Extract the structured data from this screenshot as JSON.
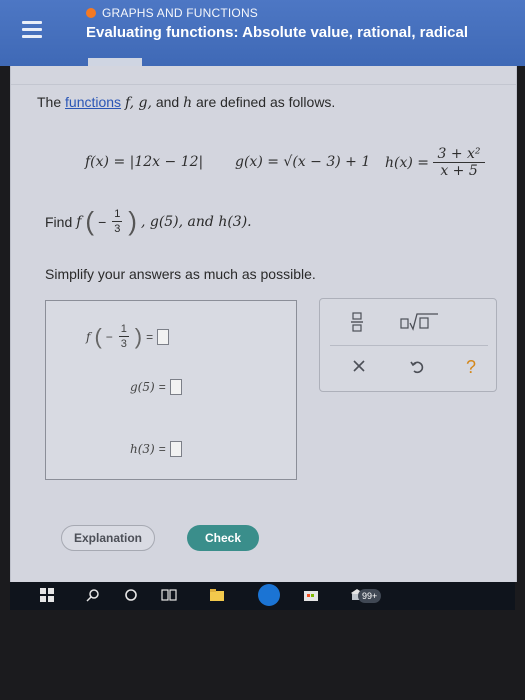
{
  "header": {
    "topic": "GRAPHS AND FUNCTIONS",
    "title": "Evaluating functions: Absolute value, rational, radical"
  },
  "problem": {
    "intro_prefix": "The",
    "intro_link": "functions",
    "intro_vars": "f, g,",
    "intro_and": "and",
    "intro_h": "h",
    "intro_suffix": "are defined as follows.",
    "f_def": "f(x) = |12x − 12|",
    "g_def": "g(x) = √(x − 3) + 1",
    "h_lhs": "h(x) =",
    "h_num": "3 + x²",
    "h_den": "x + 5",
    "find_label": "Find",
    "find_f_name": "f",
    "find_neg": "−",
    "find_num": "1",
    "find_den": "3",
    "find_rest": ", g(5), and h(3).",
    "simplify": "Simplify your answers as much as possible."
  },
  "answers": {
    "f_label": "f",
    "f_neg": "−",
    "f_num": "1",
    "f_den": "3",
    "equals": "=",
    "g_label": "g(5)",
    "h_label": "h(3)"
  },
  "tools": {
    "fraction_icon": "fraction-icon",
    "radical_icon": "radical-icon",
    "clear_icon": "close-icon",
    "undo_icon": "undo-icon",
    "help_label": "?"
  },
  "buttons": {
    "explanation": "Explanation",
    "check": "Check"
  },
  "taskbar": {
    "badge": "99+"
  },
  "colors": {
    "header": "#4470bd",
    "accent_orange": "#ff7a1a",
    "check": "#3a8e8b",
    "panel": "#d3d5de"
  }
}
